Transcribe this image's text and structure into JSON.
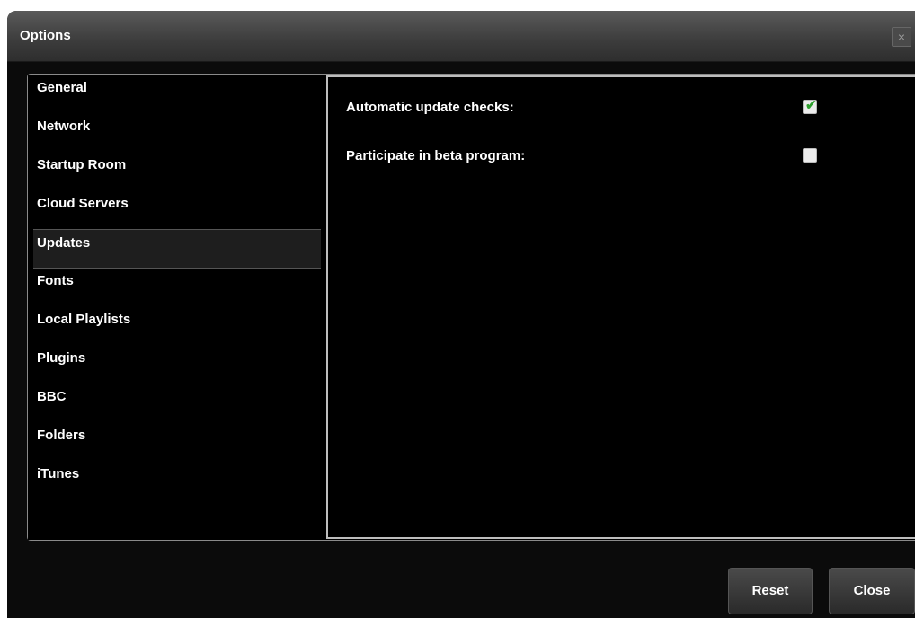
{
  "window": {
    "title": "Options",
    "close_glyph": "×"
  },
  "sidebar": {
    "items": [
      {
        "label": "General"
      },
      {
        "label": "Network"
      },
      {
        "label": "Startup Room"
      },
      {
        "label": "Cloud Servers"
      },
      {
        "label": "Updates",
        "selected": true
      },
      {
        "label": "Fonts"
      },
      {
        "label": "Local Playlists"
      },
      {
        "label": "Plugins"
      },
      {
        "label": "BBC"
      },
      {
        "label": "Folders"
      },
      {
        "label": "iTunes"
      }
    ]
  },
  "content": {
    "options": [
      {
        "label": "Automatic update checks:",
        "checked": true
      },
      {
        "label": "Participate in beta program:",
        "checked": false
      }
    ]
  },
  "footer": {
    "reset_label": "Reset",
    "close_label": "Close"
  },
  "colors": {
    "background": "#000000",
    "check_accent": "#2ea02e"
  }
}
